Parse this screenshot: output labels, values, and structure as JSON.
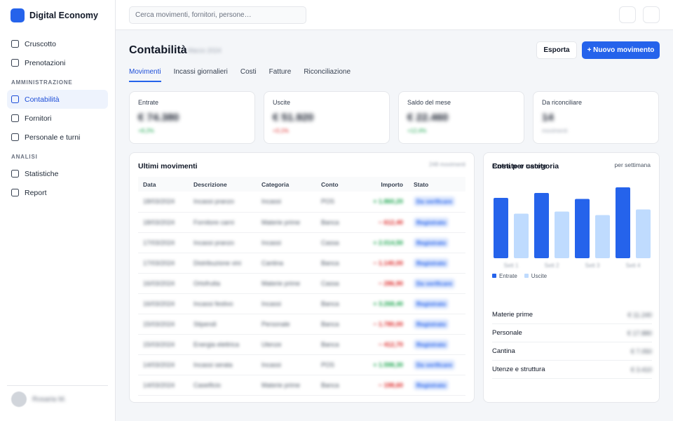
{
  "app": {
    "name": "Digital Economy"
  },
  "search": {
    "placeholder": "Cerca movimenti, fornitori, persone…"
  },
  "sidebar": {
    "top_items": [
      {
        "label": "Cruscotto"
      },
      {
        "label": "Prenotazioni"
      }
    ],
    "sections": [
      {
        "title": "AMMINISTRAZIONE",
        "items": [
          {
            "label": "Contabilità",
            "active": true
          },
          {
            "label": "Fornitori"
          },
          {
            "label": "Personale e turni"
          }
        ]
      },
      {
        "title": "ANALISI",
        "items": [
          {
            "label": "Statistiche"
          },
          {
            "label": "Report"
          }
        ]
      }
    ],
    "user": {
      "name": "Rosaria M."
    }
  },
  "page": {
    "title": "Contabilità",
    "subtitle": "Marzo 2024",
    "export_label": "Esporta",
    "new_label": "+ Nuovo movimento",
    "tabs": [
      "Movimenti",
      "Incassi giornalieri",
      "Costi",
      "Fatture",
      "Riconciliazione"
    ]
  },
  "stats": [
    {
      "label": "Entrate",
      "value": "€ 74.380",
      "delta": "+8,2%",
      "delta_color": "#16a34a"
    },
    {
      "label": "Uscite",
      "value": "€ 51.920",
      "delta": "+3,1%",
      "delta_color": "#dc2626"
    },
    {
      "label": "Saldo del mese",
      "value": "€ 22.460",
      "delta": "+12,4%",
      "delta_color": "#16a34a"
    },
    {
      "label": "Da riconciliare",
      "value": "14",
      "delta": "movimenti",
      "delta_color": "#9ca3af"
    }
  ],
  "movements": {
    "title": "Ultimi movimenti",
    "count": "248 movimenti",
    "columns": [
      "Data",
      "Descrizione",
      "Categoria",
      "Conto",
      "Importo",
      "Stato"
    ],
    "rows": [
      [
        "18/03/2024",
        "Incassi pranzo",
        "Incassi",
        "POS",
        "+ 1.860,20",
        "Da verificare"
      ],
      [
        "18/03/2024",
        "Fornitore carni",
        "Materie prime",
        "Banca",
        "− 612,40",
        "Registrato"
      ],
      [
        "17/03/2024",
        "Incassi pranzo",
        "Incassi",
        "Cassa",
        "+ 2.014,50",
        "Registrato"
      ],
      [
        "17/03/2024",
        "Distribuzione vini",
        "Cantina",
        "Banca",
        "− 1.140,00",
        "Registrato"
      ],
      [
        "16/03/2024",
        "Ortofrutta",
        "Materie prime",
        "Cassa",
        "− 286,90",
        "Da verificare"
      ],
      [
        "16/03/2024",
        "Incassi festivo",
        "Incassi",
        "Banca",
        "+ 3.268,40",
        "Registrato"
      ],
      [
        "15/03/2024",
        "Stipendi",
        "Personale",
        "Banca",
        "− 1.780,00",
        "Registrato"
      ],
      [
        "15/03/2024",
        "Energia elettrica",
        "Utenze",
        "Banca",
        "− 412,70",
        "Registrato"
      ],
      [
        "14/03/2024",
        "Incassi serata",
        "Incassi",
        "POS",
        "+ 1.598,30",
        "Da verificare"
      ],
      [
        "14/03/2024",
        "Caseificio",
        "Materie prime",
        "Banca",
        "− 198,60",
        "Registrato"
      ]
    ],
    "row_signs": [
      "pos",
      "neg",
      "pos",
      "neg",
      "neg",
      "pos",
      "neg",
      "neg",
      "pos",
      "neg"
    ]
  },
  "chart": {
    "title": "Entrate e uscite",
    "period": "per settimana",
    "x_labels": [
      "Sett 1",
      "Sett 2",
      "Sett 3",
      "Sett 4"
    ],
    "legend": [
      "Entrate",
      "Uscite"
    ],
    "colors": {
      "entrate": "#2563eb",
      "uscite": "#bfdbfe"
    }
  },
  "chart_data": {
    "type": "bar",
    "categories": [
      "Sett 1",
      "Sett 2",
      "Sett 3",
      "Sett 4"
    ],
    "series": [
      {
        "name": "Entrate",
        "values": [
          17.2,
          18.6,
          16.9,
          20.2
        ]
      },
      {
        "name": "Uscite",
        "values": [
          12.7,
          13.3,
          12.3,
          13.9
        ]
      }
    ],
    "ylim": [
      0,
      22
    ],
    "legend": "bottom-left",
    "grid": false
  },
  "costs": {
    "title": "Costi per categoria",
    "rows": [
      {
        "label": "Materie prime",
        "value": "€ 11.240"
      },
      {
        "label": "Personale",
        "value": "€ 17.880"
      },
      {
        "label": "Cantina",
        "value": "€ 7.050"
      },
      {
        "label": "Utenze e struttura",
        "value": "€ 3.410"
      }
    ]
  }
}
